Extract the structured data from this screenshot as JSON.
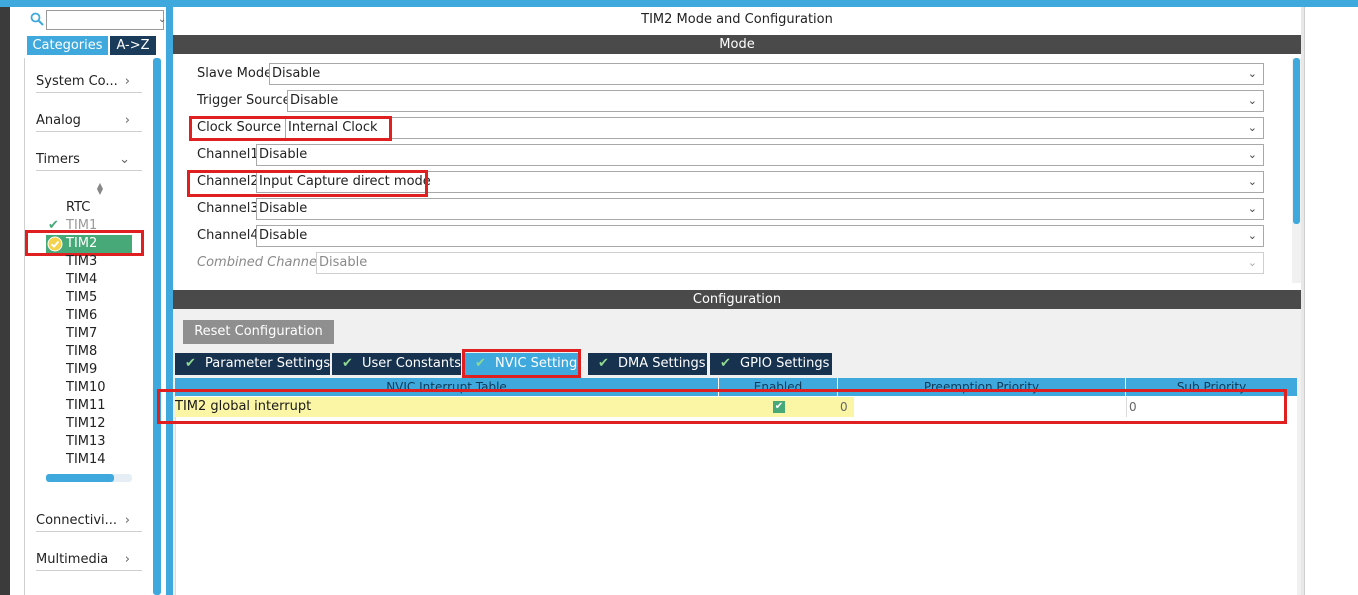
{
  "left": {
    "search": {
      "placeholder": "",
      "value": ""
    },
    "tabs": {
      "categories": "Categories",
      "az": "A->Z"
    },
    "categories": [
      {
        "label": "System Co...",
        "chevron": ">"
      },
      {
        "label": "Analog",
        "chevron": ">"
      },
      {
        "label": "Timers",
        "chevron": "v"
      },
      {
        "label": "Connectivi...",
        "chevron": ">"
      },
      {
        "label": "Multimedia",
        "chevron": ">"
      }
    ],
    "timers": [
      "RTC",
      "TIM1",
      "TIM2",
      "TIM3",
      "TIM4",
      "TIM5",
      "TIM6",
      "TIM7",
      "TIM8",
      "TIM9",
      "TIM10",
      "TIM11",
      "TIM12",
      "TIM13",
      "TIM14"
    ],
    "selected_timer": "TIM2"
  },
  "main": {
    "title": "TIM2 Mode and Configuration",
    "mode_header": "Mode",
    "fields": [
      {
        "label": "Slave Mode",
        "value": "Disable"
      },
      {
        "label": "Trigger Source",
        "value": "Disable"
      },
      {
        "label": "Clock Source",
        "value": "Internal Clock"
      },
      {
        "label": "Channel1",
        "value": "Disable"
      },
      {
        "label": "Channel2",
        "value": "Input Capture direct mode"
      },
      {
        "label": "Channel3",
        "value": "Disable"
      },
      {
        "label": "Channel4",
        "value": "Disable"
      },
      {
        "label": "Combined Channels",
        "value": "Disable"
      }
    ],
    "config_header": "Configuration",
    "reset_label": "Reset Configuration",
    "tabs": [
      "Parameter Settings",
      "User Constants",
      "NVIC Settings",
      "DMA Settings",
      "GPIO Settings"
    ],
    "active_tab": "NVIC Settings",
    "table": {
      "columns": [
        "NVIC Interrupt Table",
        "Enabled",
        "Preemption Priority",
        "Sub Priority"
      ],
      "rows": [
        {
          "name": "TIM2 global interrupt",
          "enabled": true,
          "preemption": "0",
          "sub": "0"
        }
      ]
    }
  },
  "colors": {
    "accent": "#3fa9dd",
    "tab_dark": "#16324f",
    "highlight_green": "#47a878",
    "annotation_red": "#e02020",
    "row_yellow": "#fbf6a6"
  }
}
